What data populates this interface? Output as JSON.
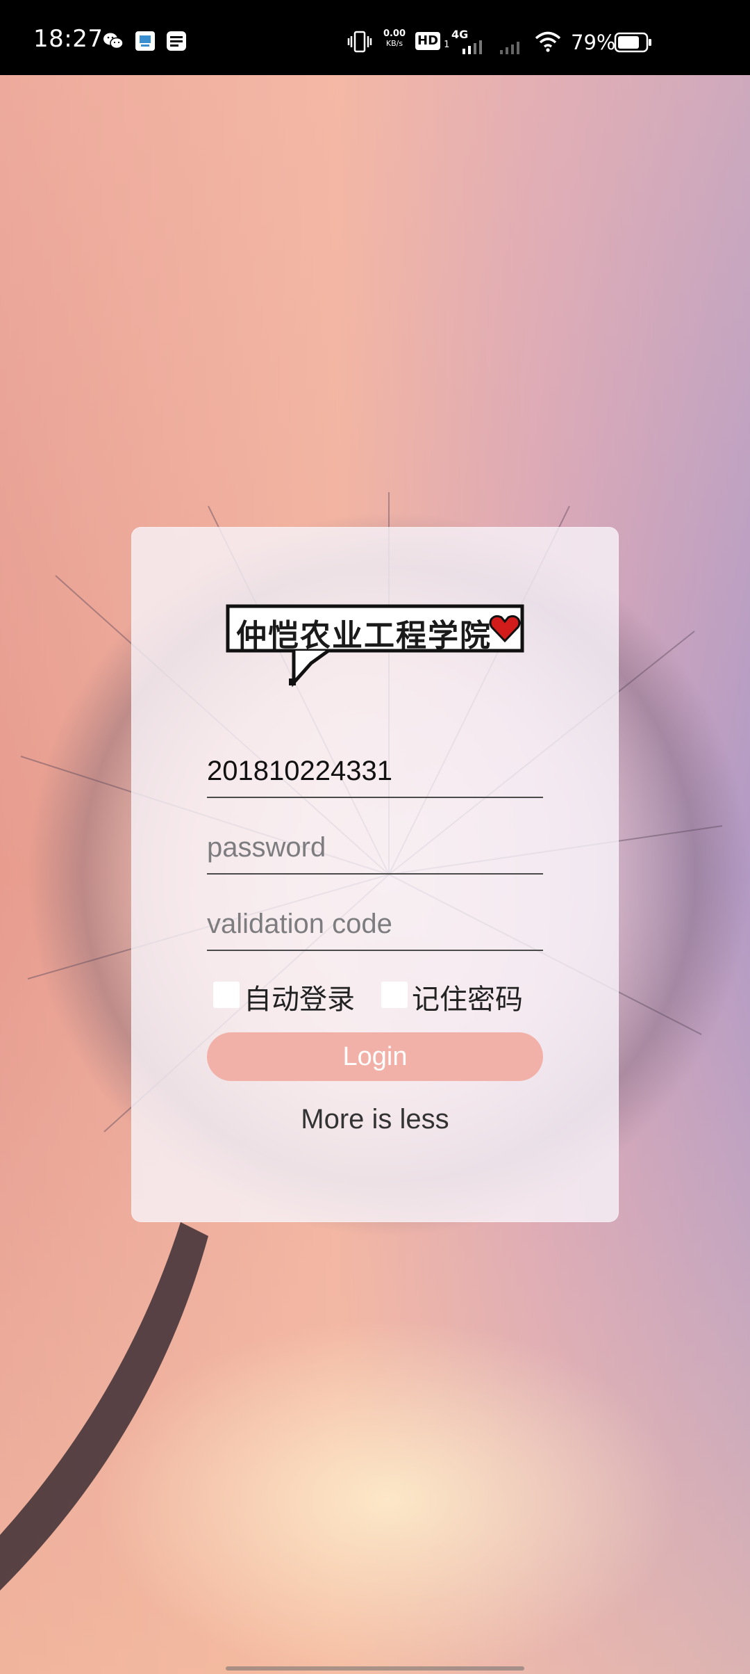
{
  "status_bar": {
    "time": "18:27",
    "net_speed_value": "0.00",
    "net_speed_unit": "KB/s",
    "hd_label": "HD",
    "hd_sub": "1",
    "network_type": "4G",
    "battery_percent": "79%",
    "battery_level": 0.79,
    "left_icons": [
      "wechat-icon",
      "notification-app-icon",
      "message-app-icon"
    ],
    "right_icons": [
      "vibrate-icon",
      "signal-icon",
      "wifi-icon",
      "battery-icon"
    ]
  },
  "login": {
    "logo_text": "仲恺农业工程学院",
    "logo_icon": "heart-icon",
    "username_value": "201810224331",
    "password_placeholder": "password",
    "validation_placeholder": "validation code",
    "auto_login_label": "自动登录",
    "auto_login_checked": false,
    "remember_label": "记住密码",
    "remember_checked": false,
    "login_button": "Login",
    "more_link": "More is less"
  },
  "colors": {
    "button": "#f2b1a8",
    "card": "#f6f2f8",
    "status_bar": "#000000"
  }
}
